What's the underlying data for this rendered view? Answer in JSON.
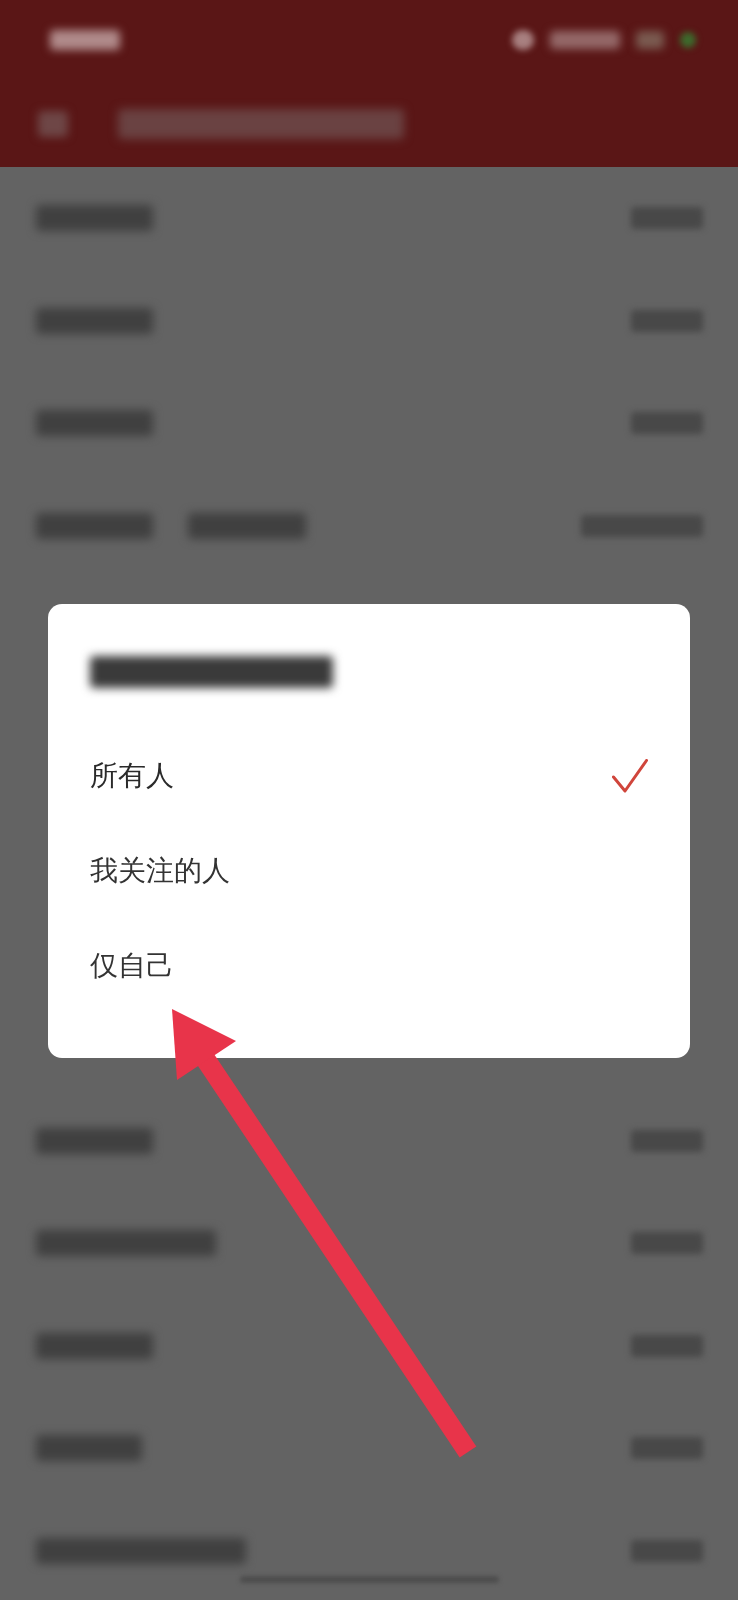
{
  "dialog": {
    "options": [
      {
        "label": "所有人",
        "selected": true
      },
      {
        "label": "我关注的人",
        "selected": false
      },
      {
        "label": "仅自己",
        "selected": false
      }
    ]
  },
  "annotations": [
    {
      "kind": "arrow"
    }
  ]
}
